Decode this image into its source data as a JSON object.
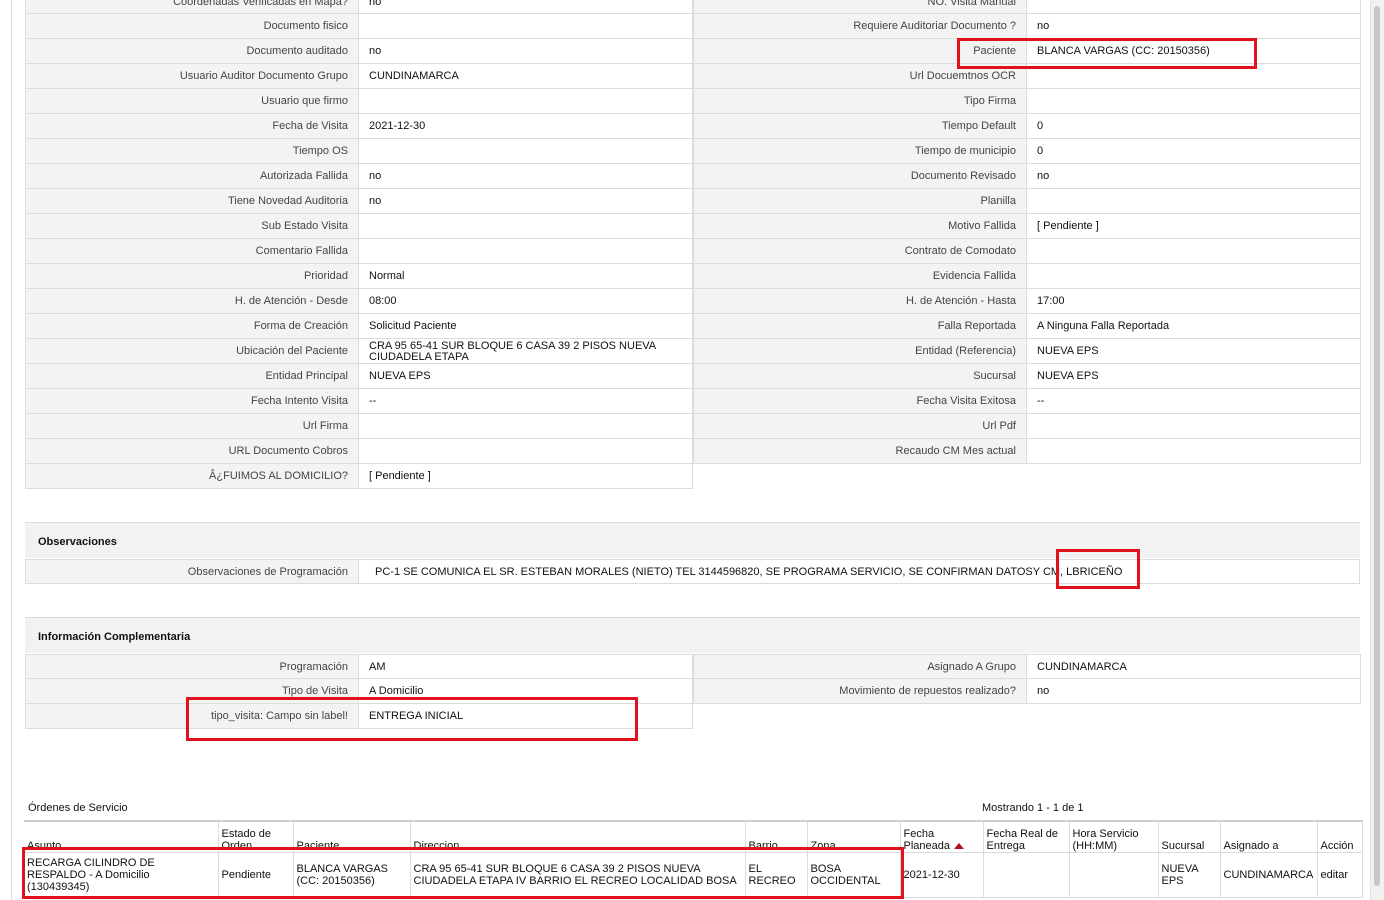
{
  "details": {
    "left": [
      {
        "label": "Coordenadas Verificadas en Mapa?",
        "value": "no"
      },
      {
        "label": "Documento fisico",
        "value": ""
      },
      {
        "label": "Documento auditado",
        "value": "no"
      },
      {
        "label": "Usuario Auditor Documento Grupo",
        "value": "CUNDINAMARCA"
      },
      {
        "label": "Usuario que firmo",
        "value": ""
      },
      {
        "label": "Fecha de Visita",
        "value": "2021-12-30"
      },
      {
        "label": "Tiempo OS",
        "value": ""
      },
      {
        "label": "Autorizada Fallida",
        "value": "no"
      },
      {
        "label": "Tiene Novedad Auditoria",
        "value": "no"
      },
      {
        "label": "Sub Estado Visita",
        "value": ""
      },
      {
        "label": "Comentario Fallida",
        "value": ""
      },
      {
        "label": "Prioridad",
        "value": "Normal"
      },
      {
        "label": "H. de Atención - Desde",
        "value": "08:00"
      },
      {
        "label": "Forma de Creación",
        "value": "Solicitud Paciente"
      },
      {
        "label": "Ubicación del Paciente",
        "value": "CRA 95 65-41 SUR BLOQUE 6 CASA 39 2 PISOS NUEVA CIUDADELA ETAPA"
      },
      {
        "label": "Entidad Principal",
        "value": "NUEVA EPS"
      },
      {
        "label": "Fecha Intento Visita",
        "value": "--"
      },
      {
        "label": "Url Firma",
        "value": ""
      },
      {
        "label": "URL Documento Cobros",
        "value": ""
      },
      {
        "label": "Â¿FUIMOS AL DOMICILIO?",
        "value": "[ Pendiente ]"
      }
    ],
    "right": [
      {
        "label": "NO. Visita Manual",
        "value": ""
      },
      {
        "label": "Requiere Auditoriar Documento ?",
        "value": "no"
      },
      {
        "label": "Paciente",
        "value": "BLANCA VARGAS (CC: 20150356)"
      },
      {
        "label": "Url Docuemtnos OCR",
        "value": ""
      },
      {
        "label": "Tipo Firma",
        "value": ""
      },
      {
        "label": "Tiempo Default",
        "value": "0"
      },
      {
        "label": "Tiempo de municipio",
        "value": "0"
      },
      {
        "label": "Documento Revisado",
        "value": "no"
      },
      {
        "label": "Planilla",
        "value": ""
      },
      {
        "label": "Motivo Fallida",
        "value": "[ Pendiente ]"
      },
      {
        "label": "Contrato de Comodato",
        "value": ""
      },
      {
        "label": "Evidencia Fallida",
        "value": ""
      },
      {
        "label": "H. de Atención - Hasta",
        "value": "17:00"
      },
      {
        "label": "Falla Reportada",
        "value": "A Ninguna Falla Reportada"
      },
      {
        "label": "Entidad (Referencia)",
        "value": "NUEVA EPS"
      },
      {
        "label": "Sucursal",
        "value": "NUEVA EPS"
      },
      {
        "label": "Fecha Visita Exitosa",
        "value": "--"
      },
      {
        "label": "Url Pdf",
        "value": ""
      },
      {
        "label": "Recaudo CM Mes actual",
        "value": ""
      }
    ]
  },
  "observaciones": {
    "title": "Observaciones",
    "label": "Observaciones de Programación",
    "value": "PC-1 SE COMUNICA EL SR. ESTEBAN MORALES (NIETO) TEL 3144596820, SE PROGRAMA SERVICIO, SE CONFIRMAN DATOSY CM, LBRICEÑO"
  },
  "complementaria": {
    "title": "Información Complementaria",
    "left": [
      {
        "label": "Programación",
        "value": "AM"
      },
      {
        "label": "Tipo de Visita",
        "value": "A Domicilio"
      },
      {
        "label": "tipo_visita: Campo sin label!",
        "value": "ENTREGA INICIAL"
      }
    ],
    "right": [
      {
        "label": "Asignado A Grupo",
        "value": "CUNDINAMARCA"
      },
      {
        "label": "Movimiento de repuestos realizado?",
        "value": "no"
      }
    ]
  },
  "orders": {
    "title": "Órdenes de Servicio",
    "count": "Mostrando 1 - 1 de 1",
    "columns": [
      "Asunto",
      "Estado de Orden",
      "Paciente",
      "Direccion",
      "Barrio",
      "Zona",
      "Fecha Planeada",
      "Fecha Real de Entrega",
      "Hora Servicio (HH:MM)",
      "Sucursal",
      "Asignado a",
      "Acción"
    ],
    "rows": [
      {
        "asunto": "RECARGA CILINDRO DE RESPALDO - A Domicilio (130439345)",
        "estado": "Pendiente",
        "paciente": "BLANCA VARGAS (CC: 20150356)",
        "direccion": "CRA 95 65-41 SUR BLOQUE 6 CASA 39 2 PISOS NUEVA CIUDADELA ETAPA IV BARRIO EL RECREO LOCALIDAD BOSA",
        "barrio": "EL RECREO",
        "zona": "BOSA OCCIDENTAL",
        "fecha_planeada": "2021-12-30",
        "fecha_real": "",
        "hora": "",
        "sucursal": "NUEVA EPS",
        "asignado": "CUNDINAMARCA",
        "accion": "editar"
      }
    ]
  },
  "colors": {
    "highlight": "#e1121e",
    "sort_arrow": "#b0121e",
    "label_bg": "#f3f3f3"
  }
}
